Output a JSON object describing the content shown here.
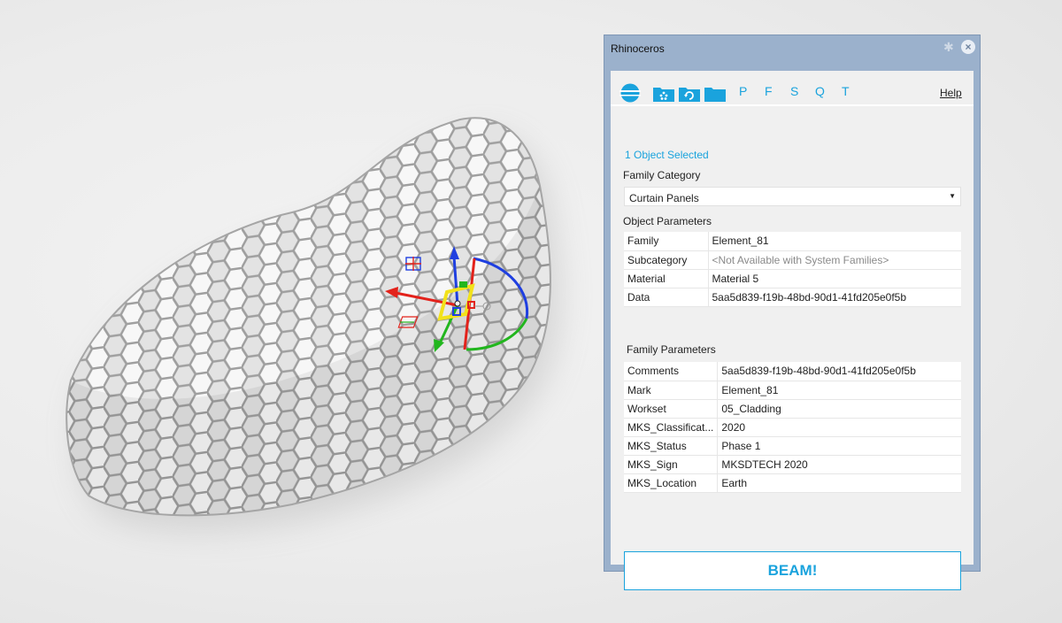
{
  "window": {
    "title": "Rhinoceros"
  },
  "toolbar": {
    "icons": [
      "logo-icon",
      "folder-dots-icon",
      "folder-refresh-icon",
      "folder-icon"
    ],
    "letters": [
      "P",
      "F",
      "S",
      "Q",
      "T"
    ],
    "help": "Help"
  },
  "selection": {
    "status": "1 Object Selected"
  },
  "family_category": {
    "label": "Family Category",
    "selected": "Curtain Panels"
  },
  "object_parameters": {
    "label": "Object Parameters",
    "rows": [
      {
        "key": "Family",
        "value": "Element_81"
      },
      {
        "key": "Subcategory",
        "value": "<Not Available with System Families>"
      },
      {
        "key": "Material",
        "value": "Material 5"
      },
      {
        "key": "Data",
        "value": "5aa5d839-f19b-48bd-90d1-41fd205e0f5b"
      }
    ]
  },
  "family_parameters": {
    "label": "Family Parameters",
    "rows": [
      {
        "key": "Comments",
        "value": "5aa5d839-f19b-48bd-90d1-41fd205e0f5b"
      },
      {
        "key": "Mark",
        "value": "Element_81"
      },
      {
        "key": "Workset",
        "value": "05_Cladding"
      },
      {
        "key": "MKS_Classificat...",
        "value": "2020"
      },
      {
        "key": "MKS_Status",
        "value": "Phase 1"
      },
      {
        "key": "MKS_Sign",
        "value": "MKSDTECH 2020"
      },
      {
        "key": "MKS_Location",
        "value": "Earth"
      }
    ]
  },
  "actions": {
    "beam": "BEAM!"
  },
  "colors": {
    "accent": "#1aa3dd",
    "panel_frame": "#9bb1cc",
    "gizmo_x": "#e3221b",
    "gizmo_y": "#22b61e",
    "gizmo_z": "#1f3fe0",
    "gizmo_handle": "#f2e21a"
  }
}
